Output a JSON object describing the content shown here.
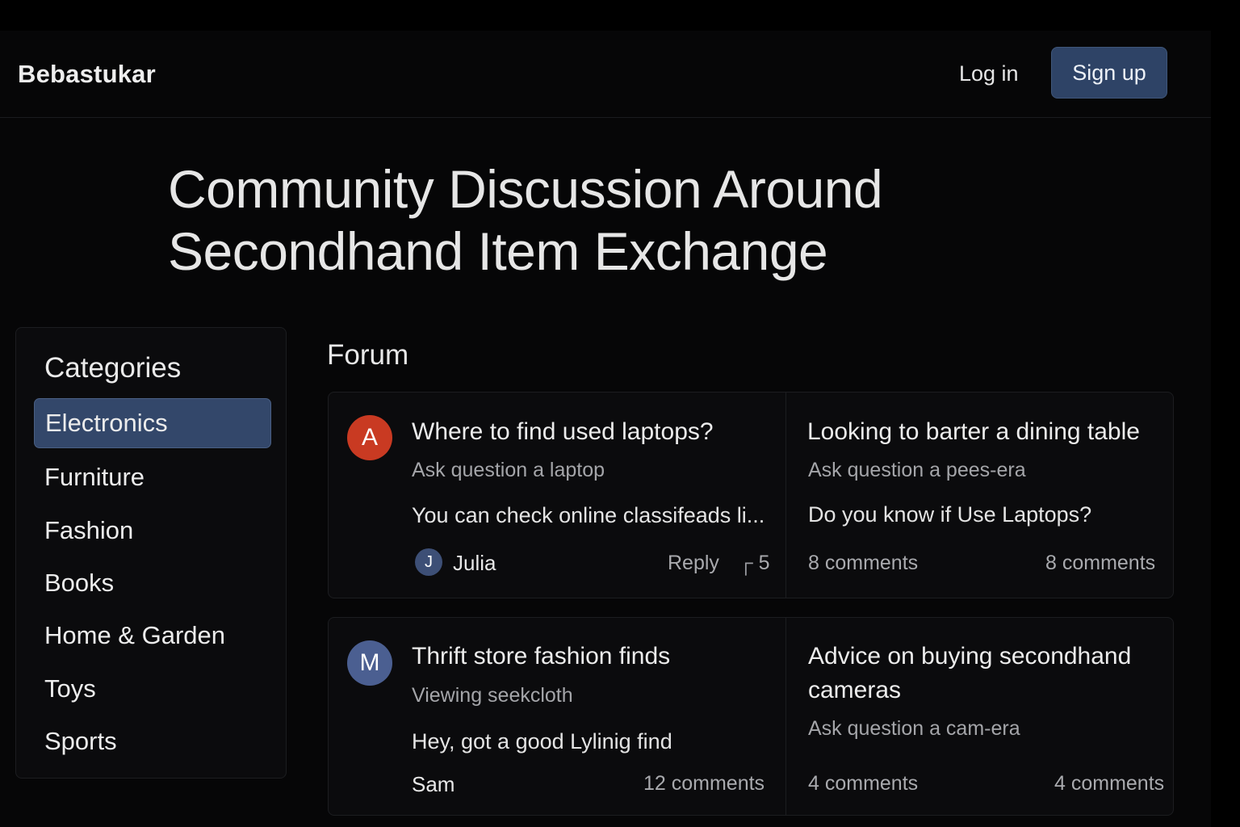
{
  "header": {
    "brand": "Bebastukar",
    "login_label": "Log in",
    "signup_label": "Sign up"
  },
  "hero": {
    "line1": "Community Discussion Around",
    "line2": "Secondhand Item Exchange"
  },
  "sidebar": {
    "title": "Categories",
    "items": [
      {
        "label": "Electronics",
        "active": true
      },
      {
        "label": "Furniture"
      },
      {
        "label": "Fashion"
      },
      {
        "label": "Books"
      },
      {
        "label": "Home & Garden"
      },
      {
        "label": "Toys"
      },
      {
        "label": "Sports"
      }
    ]
  },
  "forum": {
    "title": "Forum",
    "posts": [
      {
        "avatar": "A",
        "title": "Where to find used laptops?",
        "subtitle": "Ask question a laptop",
        "body": "You can check online classifeads li...",
        "author_initial": "J",
        "author": "Julia",
        "reply_label": "Reply",
        "reply_count": "5"
      },
      {
        "title": "Looking to barter a dining table",
        "subtitle": "Ask question a pees-era",
        "body": "Do you know if Use Laptops?",
        "comments_left": "8 comments",
        "comments_right": "8 comments"
      },
      {
        "avatar": "M",
        "title": "Thrift store fashion finds",
        "subtitle": "Viewing seekcloth",
        "body": "Hey, got a good Lylinig find",
        "author": "Sam",
        "comments": "12 comments"
      },
      {
        "title_line1": "Advice on buying secondhand",
        "title_line2": "cameras",
        "subtitle": "Ask question a cam-era",
        "comments_left": "4 comments",
        "comments_right": "4 comments"
      }
    ]
  },
  "colors": {
    "background": "#060607",
    "card": "#0b0b0d",
    "accent": "#2e4366",
    "active_category": "#33476a",
    "avatar_red": "#c93a22",
    "avatar_blue": "#4b5f91"
  }
}
